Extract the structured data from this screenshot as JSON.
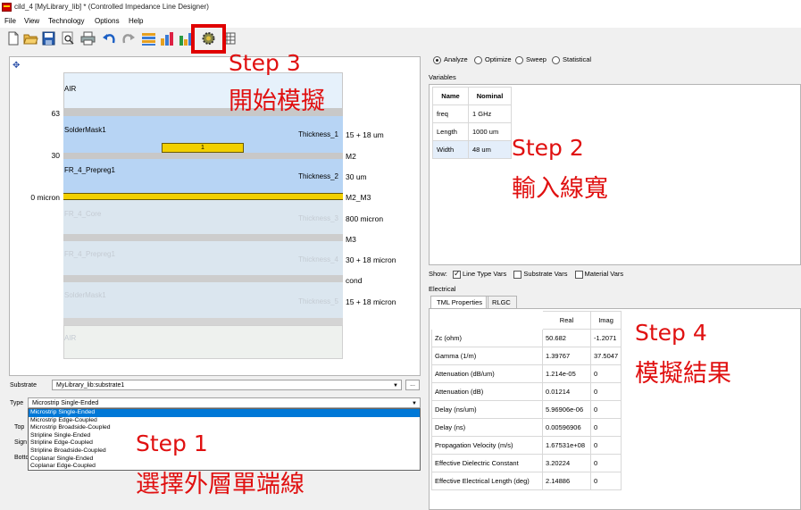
{
  "window": {
    "title": "cild_4 [MyLibrary_lib] * (Controlled Impedance Line Designer)"
  },
  "menu": [
    "File",
    "View",
    "Technology",
    "Options",
    "Help"
  ],
  "toolbar": {
    "icons": [
      "new-file-icon",
      "open-folder-icon",
      "save-icon",
      "zoom-icon",
      "print-icon",
      "undo-icon",
      "redo-icon",
      "layer-chart-icon",
      "bar-chart-icon",
      "bar-chart-2-icon",
      "simulate-gear-icon",
      "grid-icon"
    ]
  },
  "stackup": {
    "layers": [
      {
        "name": "AIR",
        "thickness_label": "",
        "value": "",
        "dim": false
      },
      {
        "name": "SolderMask1",
        "thickness_label": "Thickness_1",
        "value": "15 + 18 um",
        "dim": false
      },
      {
        "name": "FR_4_Prepreg1",
        "thickness_label": "Thickness_2",
        "value": "30 um",
        "dim": false
      },
      {
        "name": "FR_4_Core",
        "thickness_label": "Thickness_3",
        "value": "800 micron",
        "dim": true
      },
      {
        "name": "FR_4_Prepreg1",
        "thickness_label": "Thickness_4",
        "value": "30 + 18 micron",
        "dim": true
      },
      {
        "name": "SolderMask1",
        "thickness_label": "Thickness_5",
        "value": "15 + 18 micron",
        "dim": true
      },
      {
        "name": "AIR",
        "thickness_label": "",
        "value": "",
        "dim": true
      }
    ],
    "conductors": [
      "M2",
      "M2_M3",
      "M3",
      "cond"
    ],
    "trace_label": "1",
    "y_labels": [
      "63",
      "30",
      "0 micron"
    ]
  },
  "substrate": {
    "label": "Substrate",
    "value": "MyLibrary_lib:substrate1",
    "browse": "..."
  },
  "type": {
    "label": "Type",
    "selected": "Microstrip Single-Ended",
    "options": [
      "Microstrip Single-Ended",
      "Microstrip Edge-Coupled",
      "Microstrip Broadside-Coupled",
      "Stripline Single-Ended",
      "Stripline Edge-Coupled",
      "Stripline Broadside-Coupled",
      "Coplanar Single-Ended",
      "Coplanar Edge-Coupled"
    ],
    "hidden_labels": [
      "Top",
      "Sign",
      "Botto"
    ]
  },
  "mode": {
    "options": [
      "Analyze",
      "Optimize",
      "Sweep",
      "Statistical"
    ],
    "selected": "Analyze"
  },
  "variables": {
    "title": "Variables",
    "headers": [
      "Name",
      "Nominal"
    ],
    "rows": [
      [
        "freq",
        "1 GHz"
      ],
      [
        "Length",
        "1000 um"
      ],
      [
        "Width",
        "48 um"
      ]
    ]
  },
  "show": {
    "label": "Show:",
    "options": [
      {
        "label": "Line Type Vars",
        "checked": true
      },
      {
        "label": "Substrate Vars",
        "checked": false
      },
      {
        "label": "Material Vars",
        "checked": false
      }
    ]
  },
  "electrical": {
    "title": "Electrical",
    "tabs": [
      "TML Properties",
      "RLGC"
    ],
    "headers": [
      "",
      "Real",
      "Imag"
    ],
    "rows": [
      [
        "Zc (ohm)",
        "50.682",
        "-1.2071"
      ],
      [
        "Gamma (1/m)",
        "1.39767",
        "37.5047"
      ],
      [
        "Attenuation (dB/um)",
        "1.214e-05",
        "0"
      ],
      [
        "Attenuation (dB)",
        "0.01214",
        "0"
      ],
      [
        "Delay (ns/um)",
        "5.96906e-06",
        "0"
      ],
      [
        "Delay (ns)",
        "0.00596906",
        "0"
      ],
      [
        "Propagation Velocity (m/s)",
        "1.67531e+08",
        "0"
      ],
      [
        "Effective Dielectric Constant",
        "3.20224",
        "0"
      ],
      [
        "Effective Electrical Length (deg)",
        "2.14886",
        "0"
      ]
    ]
  },
  "annotations": {
    "step1": {
      "title": "Step 1",
      "text": "選擇外層單端線"
    },
    "step2": {
      "title": "Step 2",
      "text": "輸入線寬"
    },
    "step3": {
      "title": "Step 3",
      "text": "開始模擬"
    },
    "step4": {
      "title": "Step 4",
      "text": "模擬結果"
    }
  }
}
